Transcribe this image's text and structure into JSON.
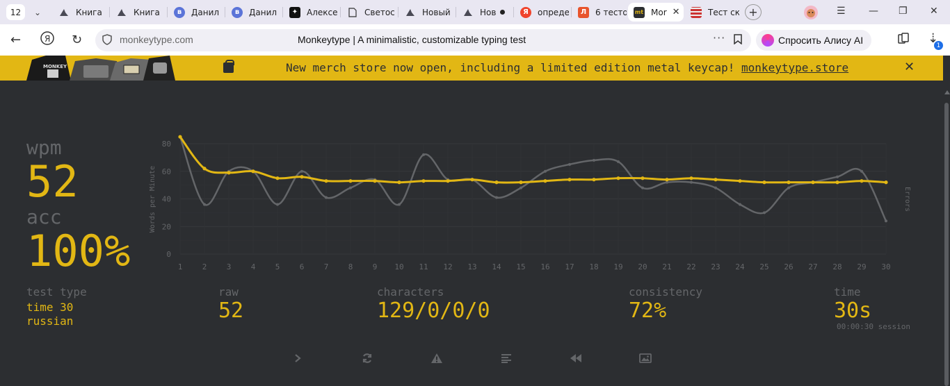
{
  "browser": {
    "tab_count": "12",
    "tabs": [
      {
        "title": "Книга",
        "icon": "monkeytype-tab-icon"
      },
      {
        "title": "Книга",
        "icon": "monkeytype-tab-icon"
      },
      {
        "title": "Данил",
        "icon": "vk-tab-icon"
      },
      {
        "title": "Данил",
        "icon": "vk-tab-icon"
      },
      {
        "title": "Алексе",
        "icon": "sparkle-tab-icon"
      },
      {
        "title": "Светос",
        "icon": "document-tab-icon"
      },
      {
        "title": "Новый",
        "icon": "monkeytype-tab-icon"
      },
      {
        "title": "Нов",
        "icon": "monkeytype-tab-icon"
      },
      {
        "title": "опреде",
        "icon": "yandex-tab-icon"
      },
      {
        "title": "6 тесто",
        "icon": "letter-tab-icon"
      },
      {
        "title": "Mor",
        "icon": "monkeytype-logo-icon"
      },
      {
        "title": "Тест ск",
        "icon": "keyboard-tab-icon"
      }
    ],
    "address": {
      "host": "monkeytype.com",
      "page_title": "Monkeytype | A minimalistic, customizable typing test"
    },
    "alice_label": "Спросить Алису AI",
    "downloads_badge": "1"
  },
  "banner": {
    "message": "New merch store now open, including a limited edition metal keycap! ",
    "link": "monkeytype.store",
    "merch_text": "MONKEY"
  },
  "result": {
    "wpm_label": "wpm",
    "wpm": "52",
    "acc_label": "acc",
    "acc": "100%",
    "test_type_label": "test type",
    "test_mode": "time 30",
    "language": "russian",
    "raw_label": "raw",
    "raw": "52",
    "characters_label": "characters",
    "characters": "129/0/0/0",
    "consistency_label": "consistency",
    "consistency": "72%",
    "time_label": "time",
    "time": "30s",
    "session": "00:00:30 session"
  },
  "chart_data": {
    "type": "line",
    "ylabel": "Words per Minute",
    "y2label": "Errors",
    "x": [
      1,
      2,
      3,
      4,
      5,
      6,
      7,
      8,
      9,
      10,
      11,
      12,
      13,
      14,
      15,
      16,
      17,
      18,
      19,
      20,
      21,
      22,
      23,
      24,
      25,
      26,
      27,
      28,
      29,
      30
    ],
    "ylim": [
      0,
      80
    ],
    "yticks": [
      0,
      20,
      40,
      60,
      80
    ],
    "series": [
      {
        "name": "wpm",
        "color": "#e2b714",
        "values": [
          85,
          62,
          59,
          60,
          55,
          56,
          53,
          53,
          53,
          52,
          53,
          53,
          54,
          52,
          52,
          53,
          54,
          54,
          55,
          55,
          54,
          55,
          54,
          53,
          52,
          52,
          52,
          52,
          53,
          52
        ]
      },
      {
        "name": "raw",
        "color": "#646669",
        "values": [
          85,
          36,
          60,
          60,
          36,
          60,
          41,
          48,
          54,
          36,
          72,
          54,
          54,
          41,
          48,
          60,
          65,
          68,
          67,
          48,
          52,
          52,
          48,
          36,
          30,
          48,
          52,
          56,
          60,
          24
        ]
      }
    ],
    "grid": true
  },
  "actions": [
    {
      "icon": "next-test-icon"
    },
    {
      "icon": "restart-icon"
    },
    {
      "icon": "report-warning-icon"
    },
    {
      "icon": "word-history-icon"
    },
    {
      "icon": "replay-icon"
    },
    {
      "icon": "screenshot-icon"
    }
  ]
}
